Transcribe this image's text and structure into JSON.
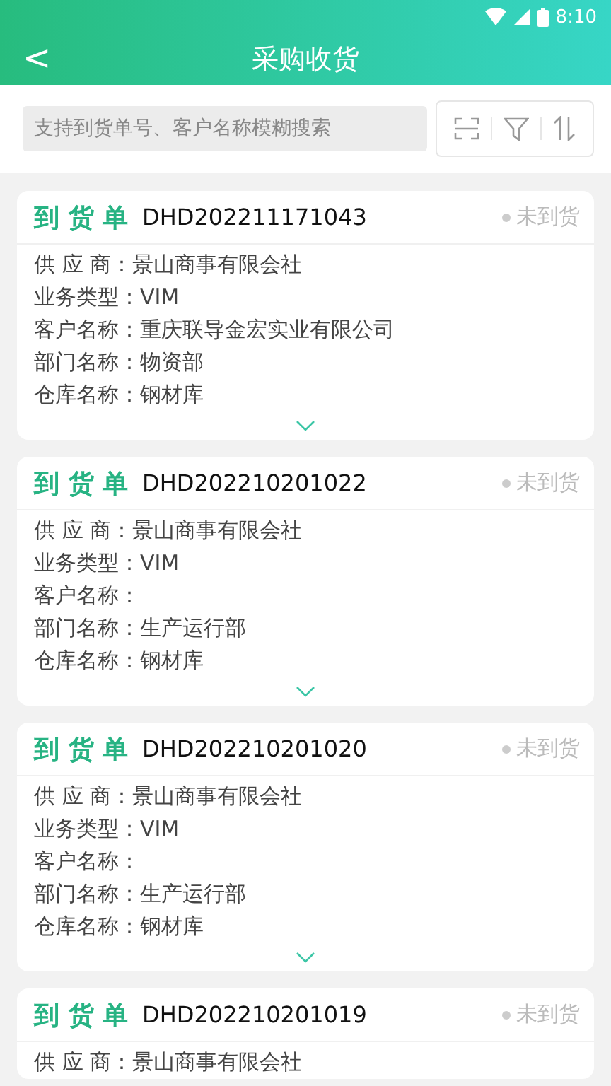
{
  "status_bar": {
    "time": "8:10"
  },
  "header": {
    "back": "<",
    "title": "采购收货"
  },
  "search": {
    "placeholder": "支持到货单号、客户名称模糊搜索"
  },
  "cards": [
    {
      "type_label": "到 货 单",
      "number": "DHD202211171043",
      "status": "未到货",
      "fields": [
        {
          "label": "供 应 商：",
          "value": "景山商事有限会社"
        },
        {
          "label": "业务类型：",
          "value": "VIM"
        },
        {
          "label": "客户名称：",
          "value": "重庆联导金宏实业有限公司"
        },
        {
          "label": "部门名称：",
          "value": "物资部"
        },
        {
          "label": "仓库名称：",
          "value": "钢材库"
        }
      ]
    },
    {
      "type_label": "到 货 单",
      "number": "DHD202210201022",
      "status": "未到货",
      "fields": [
        {
          "label": "供 应 商：",
          "value": "景山商事有限会社"
        },
        {
          "label": "业务类型：",
          "value": "VIM"
        },
        {
          "label": "客户名称："
        },
        {
          "label": "部门名称：",
          "value": "生产运行部"
        },
        {
          "label": "仓库名称：",
          "value": "钢材库"
        }
      ]
    },
    {
      "type_label": "到 货 单",
      "number": "DHD202210201020",
      "status": "未到货",
      "fields": [
        {
          "label": "供 应 商：",
          "value": "景山商事有限会社"
        },
        {
          "label": "业务类型：",
          "value": "VIM"
        },
        {
          "label": "客户名称："
        },
        {
          "label": "部门名称：",
          "value": "生产运行部"
        },
        {
          "label": "仓库名称：",
          "value": "钢材库"
        }
      ]
    },
    {
      "type_label": "到 货 单",
      "number": "DHD202210201019",
      "status": "未到货",
      "fields": [
        {
          "label": "供 应 商：",
          "value": "景山商事有限会社"
        }
      ]
    }
  ]
}
